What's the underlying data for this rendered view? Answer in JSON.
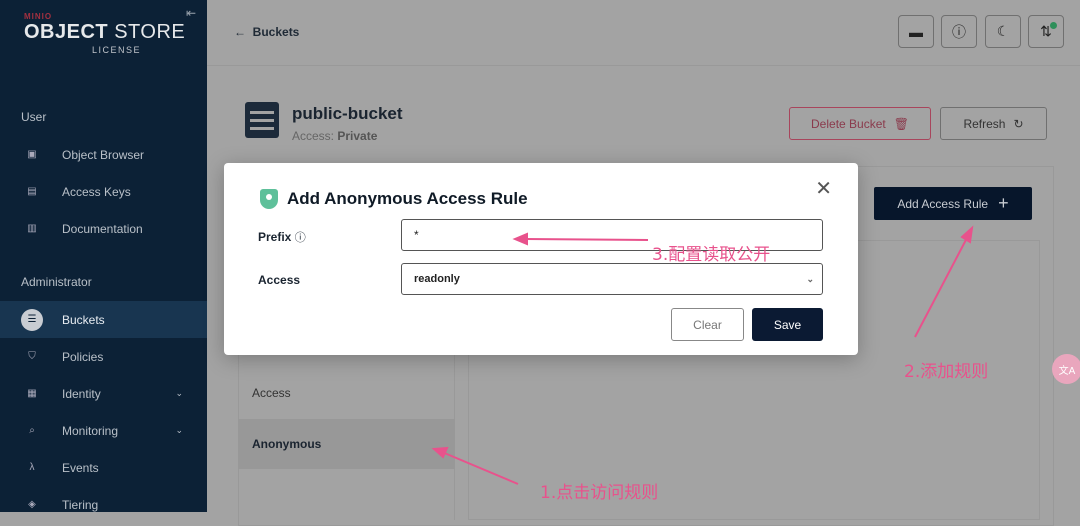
{
  "sidebar": {
    "logo_brand": "MINIO",
    "logo_product_bold": "OBJECT",
    "logo_product": "STORE",
    "logo_license": "LICENSE",
    "sections": [
      {
        "label": "User"
      },
      {
        "label": "Administrator"
      }
    ],
    "items": [
      {
        "label": "Object Browser",
        "icon": "object-browser-icon"
      },
      {
        "label": "Access Keys",
        "icon": "key-icon"
      },
      {
        "label": "Documentation",
        "icon": "document-icon"
      },
      {
        "label": "Buckets",
        "icon": "bucket-icon",
        "selected": true
      },
      {
        "label": "Policies",
        "icon": "shield-icon"
      },
      {
        "label": "Identity",
        "icon": "identity-icon"
      },
      {
        "label": "Monitoring",
        "icon": "search-icon"
      },
      {
        "label": "Events",
        "icon": "lambda-icon"
      },
      {
        "label": "Tiering",
        "icon": "tiers-icon"
      }
    ]
  },
  "header": {
    "back_label": "Buckets",
    "icons": [
      "folder-icon",
      "help-icon",
      "dark-mode-icon",
      "download-icon"
    ]
  },
  "bucket": {
    "name": "public-bucket",
    "access_label": "Access:",
    "access_value": "Private",
    "delete_label": "Delete Bucket",
    "refresh_label": "Refresh",
    "add_rule_label": "Add Access Rule"
  },
  "tabs": [
    {
      "label": "Access"
    },
    {
      "label": "Anonymous",
      "selected": true
    }
  ],
  "modal": {
    "title": "Add Anonymous Access Rule",
    "prefix_label": "Prefix",
    "prefix_value": "*",
    "access_label": "Access",
    "access_value": "readonly",
    "clear_label": "Clear",
    "save_label": "Save"
  },
  "annotations": {
    "a1": "1.点击访问规则",
    "a2": "2.添加规则",
    "a3": "3.配置读取公开",
    "color": "#e8528c"
  },
  "translate_badge": "文A"
}
